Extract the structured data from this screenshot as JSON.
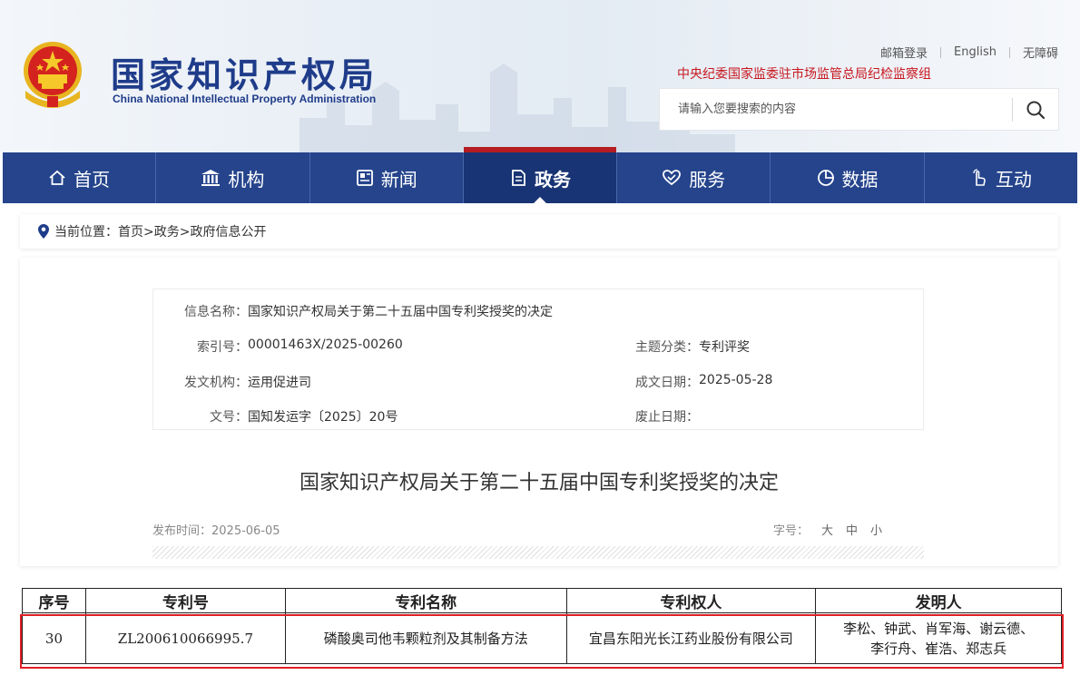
{
  "header": {
    "site_name_cn": "国家知识产权局",
    "site_name_en": "China National Intellectual Property Administration",
    "top_links": [
      "邮箱登录",
      "English",
      "无障碍"
    ],
    "supervise_text": "中央纪委国家监委驻市场监管总局纪检监察组",
    "search": {
      "placeholder": "请输入您要搜索的内容",
      "icon": "search-icon"
    }
  },
  "nav": {
    "items": [
      {
        "label": "首页",
        "icon": "home-icon"
      },
      {
        "label": "机构",
        "icon": "institution-icon"
      },
      {
        "label": "新闻",
        "icon": "news-icon"
      },
      {
        "label": "政务",
        "icon": "document-icon",
        "active": true
      },
      {
        "label": "服务",
        "icon": "service-icon"
      },
      {
        "label": "数据",
        "icon": "data-icon"
      },
      {
        "label": "互动",
        "icon": "interact-icon"
      }
    ],
    "colors": {
      "background": "#25448c",
      "active": "#183474",
      "accent": "#b51d22"
    }
  },
  "breadcrumb": {
    "text": "当前位置：首页>政务>政府信息公开",
    "icon": "location-pin-icon"
  },
  "meta": {
    "info_name_label": "信息名称：",
    "info_name_value": "国家知识产权局关于第二十五届中国专利奖授奖的决定",
    "index_label": "索引号：",
    "index_value": "00001463X/2025-00260",
    "topic_label": "主题分类：",
    "topic_value": "专利评奖",
    "issuer_label": "发文机构：",
    "issuer_value": "运用促进司",
    "date_label": "成文日期：",
    "date_value": "2025-05-28",
    "doc_no_label": "文号：",
    "doc_no_value": "国知发运字〔2025〕20号",
    "abolish_label": "废止日期：",
    "abolish_value": ""
  },
  "article": {
    "title": "国家知识产权局关于第二十五届中国专利奖授奖的决定",
    "publish_time": "发布时间：2025-06-05",
    "font_size_label": "字号：",
    "font_size_options": [
      "大",
      "中",
      "小"
    ]
  },
  "patent_table": {
    "headers": [
      "序号",
      "专利号",
      "专利名称",
      "专利权人",
      "发明人"
    ],
    "row": {
      "seq": "30",
      "patent_no": "ZL200610066995.7",
      "patent_name": "磷酸奥司他韦颗粒剂及其制备方法",
      "holder": "宜昌东阳光长江药业股份有限公司",
      "inventors_line1": "李松、钟武、肖军海、谢云德、",
      "inventors_line2": "李行舟、崔浩、郑志兵"
    },
    "highlight_color": "#e01f26"
  }
}
